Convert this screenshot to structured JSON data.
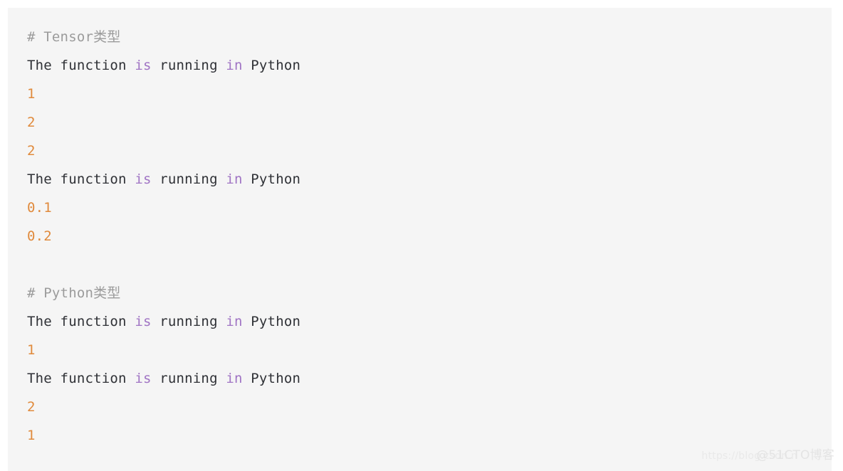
{
  "panel": {
    "name": "code-output-block",
    "background_color": "#f5f5f5",
    "page_background_color": "#ffffff"
  },
  "colors": {
    "comment": "#9b9b9b",
    "plain": "#2f3136",
    "keyword": "#a074c4",
    "number": "#e08a3c",
    "watermark": "#e7e7e7"
  },
  "lines": [
    {
      "id": "line-1",
      "kind": "comment",
      "tokens": [
        {
          "type": "comment",
          "text": "# Tensor类型"
        }
      ]
    },
    {
      "id": "line-2",
      "kind": "output",
      "tokens": [
        {
          "type": "plain",
          "text": "The function "
        },
        {
          "type": "keyword",
          "text": "is"
        },
        {
          "type": "plain",
          "text": " running "
        },
        {
          "type": "keyword",
          "text": "in"
        },
        {
          "type": "plain",
          "text": " Python"
        }
      ]
    },
    {
      "id": "line-3",
      "kind": "value",
      "tokens": [
        {
          "type": "number",
          "text": "1"
        }
      ]
    },
    {
      "id": "line-4",
      "kind": "value",
      "tokens": [
        {
          "type": "number",
          "text": "2"
        }
      ]
    },
    {
      "id": "line-5",
      "kind": "value",
      "tokens": [
        {
          "type": "number",
          "text": "2"
        }
      ]
    },
    {
      "id": "line-6",
      "kind": "output",
      "tokens": [
        {
          "type": "plain",
          "text": "The function "
        },
        {
          "type": "keyword",
          "text": "is"
        },
        {
          "type": "plain",
          "text": " running "
        },
        {
          "type": "keyword",
          "text": "in"
        },
        {
          "type": "plain",
          "text": " Python"
        }
      ]
    },
    {
      "id": "line-7",
      "kind": "value",
      "tokens": [
        {
          "type": "number",
          "text": "0.1"
        }
      ]
    },
    {
      "id": "line-8",
      "kind": "value",
      "tokens": [
        {
          "type": "number",
          "text": "0.2"
        }
      ]
    },
    {
      "id": "line-9",
      "kind": "blank",
      "tokens": []
    },
    {
      "id": "line-10",
      "kind": "comment",
      "tokens": [
        {
          "type": "comment",
          "text": "# Python类型"
        }
      ]
    },
    {
      "id": "line-11",
      "kind": "output",
      "tokens": [
        {
          "type": "plain",
          "text": "The function "
        },
        {
          "type": "keyword",
          "text": "is"
        },
        {
          "type": "plain",
          "text": " running "
        },
        {
          "type": "keyword",
          "text": "in"
        },
        {
          "type": "plain",
          "text": " Python"
        }
      ]
    },
    {
      "id": "line-12",
      "kind": "value",
      "tokens": [
        {
          "type": "number",
          "text": "1"
        }
      ]
    },
    {
      "id": "line-13",
      "kind": "output",
      "tokens": [
        {
          "type": "plain",
          "text": "The function "
        },
        {
          "type": "keyword",
          "text": "is"
        },
        {
          "type": "plain",
          "text": " running "
        },
        {
          "type": "keyword",
          "text": "in"
        },
        {
          "type": "plain",
          "text": " Python"
        }
      ]
    },
    {
      "id": "line-14",
      "kind": "value",
      "tokens": [
        {
          "type": "number",
          "text": "2"
        }
      ]
    },
    {
      "id": "line-15",
      "kind": "value",
      "tokens": [
        {
          "type": "number",
          "text": "1"
        }
      ]
    }
  ],
  "watermark": {
    "url_text": "https://blog.csdn.n",
    "brand_text": "@51CTO博客"
  }
}
